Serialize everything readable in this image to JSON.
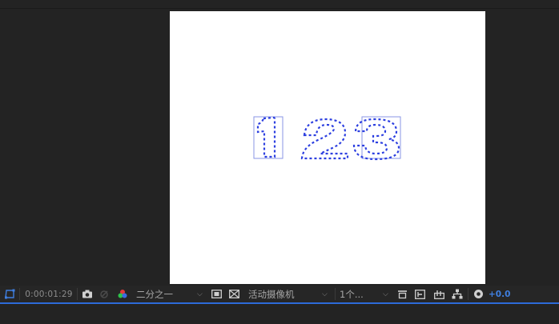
{
  "toolbar": {
    "timecode": "0:00:01:29",
    "resolution": "二分之一",
    "camera": "活动摄像机",
    "views": "1个...",
    "exposure": "+0.0"
  },
  "canvas": {
    "text_outline": "123"
  },
  "colors": {
    "panel_bg": "#232323",
    "canvas_bg": "#ffffff",
    "mask_path": "#2c3fe0",
    "accent": "#2d6bd8"
  }
}
